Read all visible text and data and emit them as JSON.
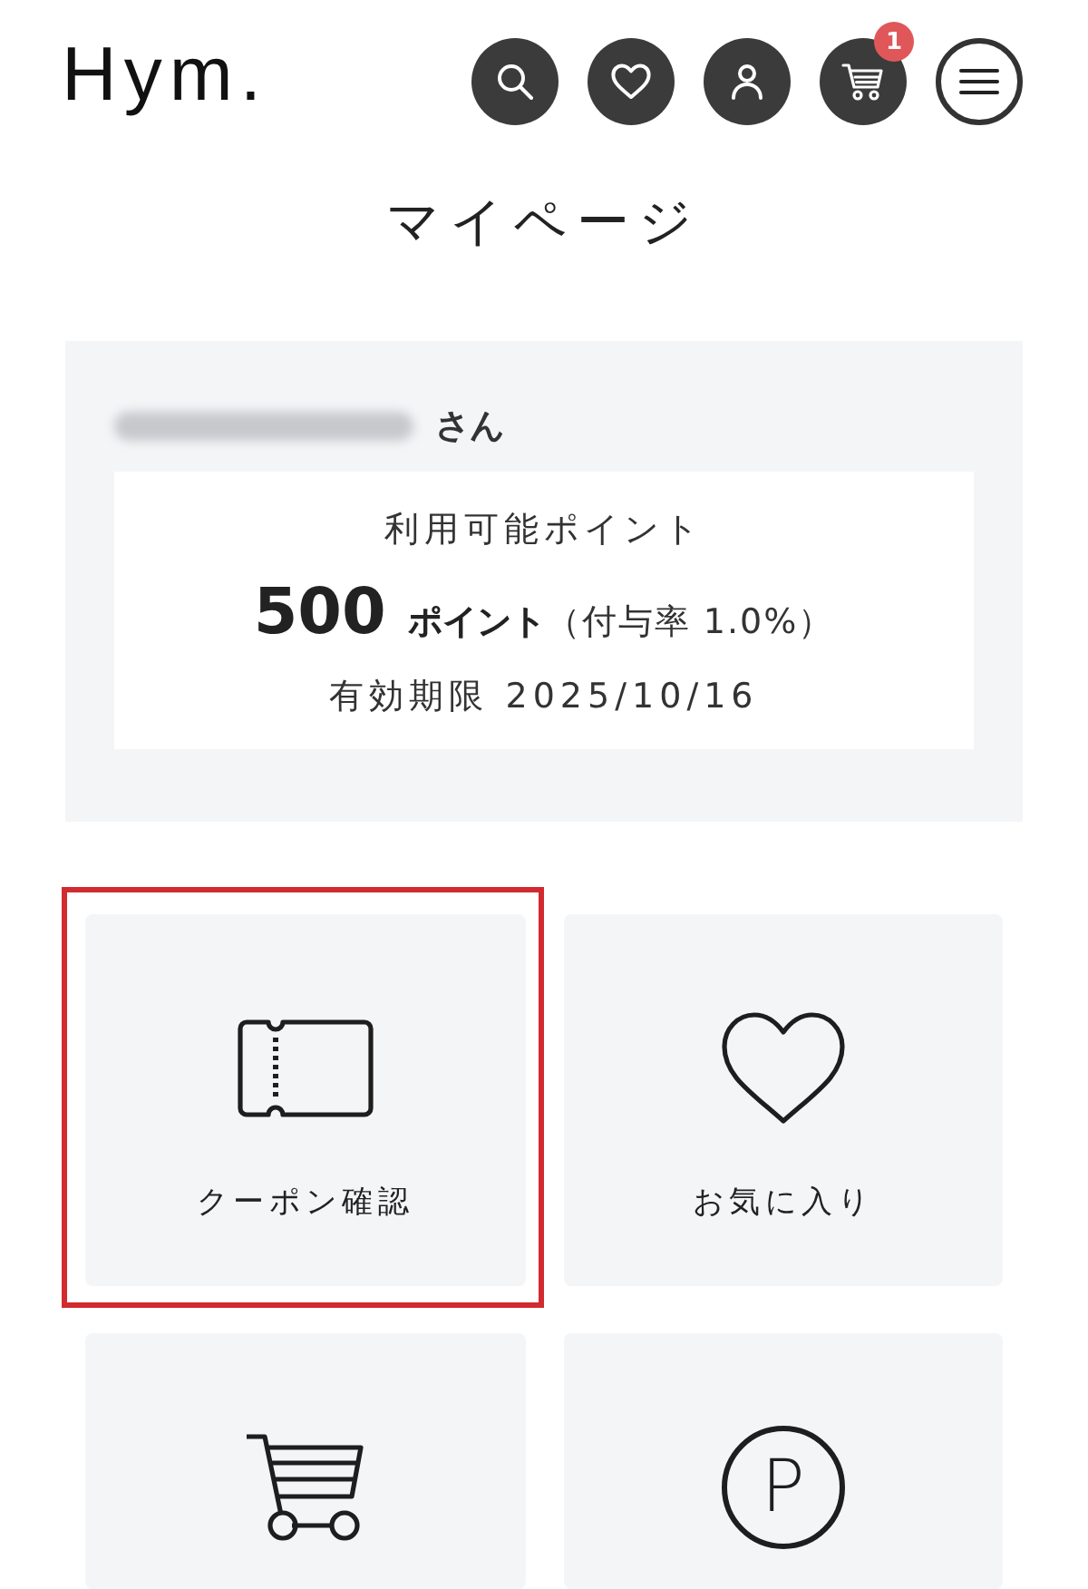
{
  "header": {
    "logo": "Hym.",
    "actions": [
      {
        "kind": "search"
      },
      {
        "kind": "favorites"
      },
      {
        "kind": "account"
      },
      {
        "kind": "cart",
        "badge": "1"
      },
      {
        "kind": "menu"
      }
    ]
  },
  "page_title": "マイページ",
  "member": {
    "name_blurred": true,
    "honorific": "さん",
    "points_label": "利用可能ポイント",
    "points": "500",
    "points_unit": "ポイント",
    "grant_rate": "（付与率 1.0%）",
    "expiry": "有効期限 2025/10/16"
  },
  "tiles": [
    {
      "kind": "coupon",
      "label": "クーポン確認",
      "highlighted": true
    },
    {
      "kind": "favorites",
      "label": "お気に入り",
      "highlighted": false
    },
    {
      "kind": "cart",
      "highlighted": false
    },
    {
      "kind": "points",
      "symbol": "P",
      "highlighted": false
    }
  ]
}
